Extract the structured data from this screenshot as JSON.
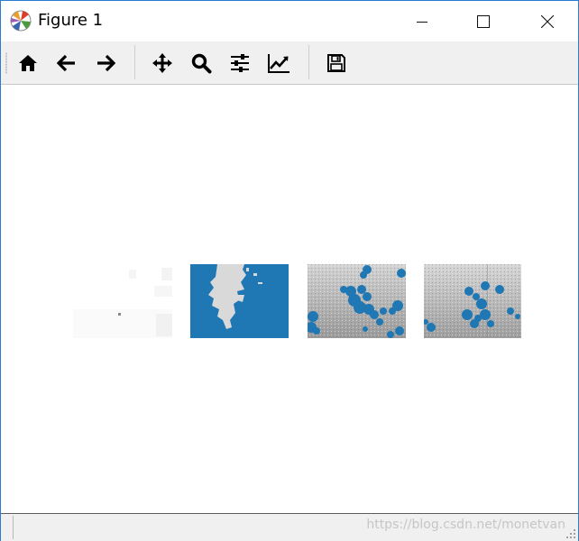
{
  "window": {
    "title": "Figure 1",
    "icon": "matplotlib-logo-icon",
    "controls": [
      "minimize-icon",
      "maximize-icon",
      "close-icon"
    ]
  },
  "toolbar": {
    "buttons": [
      {
        "name": "home",
        "icon": "home-icon"
      },
      {
        "name": "back",
        "icon": "arrow-left-icon"
      },
      {
        "name": "forward",
        "icon": "arrow-right-icon"
      },
      {
        "name": "pan",
        "icon": "move-icon"
      },
      {
        "name": "zoom",
        "icon": "magnifier-icon"
      },
      {
        "name": "configure-subplots",
        "icon": "sliders-icon"
      },
      {
        "name": "edit-axes",
        "icon": "line-chart-icon"
      },
      {
        "name": "save",
        "icon": "floppy-disk-icon"
      }
    ]
  },
  "figure": {
    "panels": [
      {
        "name": "original-image",
        "description_icon": "faint-image"
      },
      {
        "name": "mask-image",
        "accent": "#1f77b4"
      },
      {
        "name": "overlay-image-1",
        "accent": "#1f77b4"
      },
      {
        "name": "overlay-image-2",
        "accent": "#1f77b4"
      }
    ]
  },
  "statusbar": {
    "text": "",
    "watermark": "https://blog.csdn.net/monetvan"
  },
  "colors": {
    "accent": "#1f77b4",
    "window_border": "#2b7bd1",
    "toolbar_bg": "#f0f0f0"
  }
}
